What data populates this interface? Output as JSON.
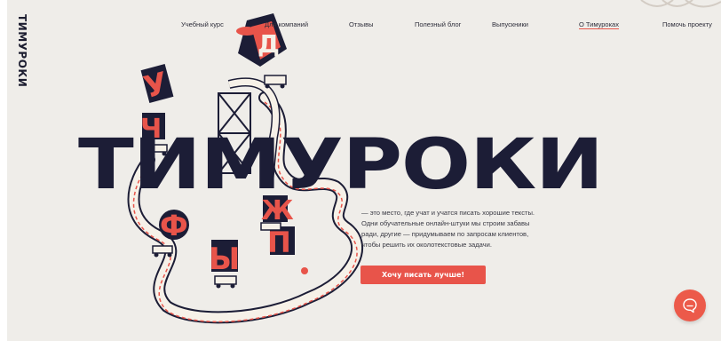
{
  "brand": {
    "logo_text": "ТИМУРОКИ"
  },
  "nav": {
    "items": [
      {
        "label": "Учебный курс"
      },
      {
        "label": "Для компаний"
      },
      {
        "label": "Отзывы"
      },
      {
        "label": "Полезный блог"
      },
      {
        "label": "Выпускники"
      },
      {
        "label": "О Тимуроках"
      },
      {
        "label": "Помочь проекту"
      }
    ],
    "active": "О Тимуроках"
  },
  "hero": {
    "title": "ТИМУРОКИ",
    "description_lines": [
      "— это место, где учат и учатся писать хорошие тексты.",
      "Одни обучательные онлайн-штуки мы строим забавы",
      "ради, другие — придумываем по запросам клиентов,",
      "чтобы решить их околотекстовые задачи."
    ],
    "cta_label": "Хочу писать лучше!"
  },
  "chat_widget": {
    "icon": "chat-bubble-icon"
  },
  "colors": {
    "background": "#efede9",
    "ink": "#1c1d36",
    "accent": "#e8544a"
  }
}
